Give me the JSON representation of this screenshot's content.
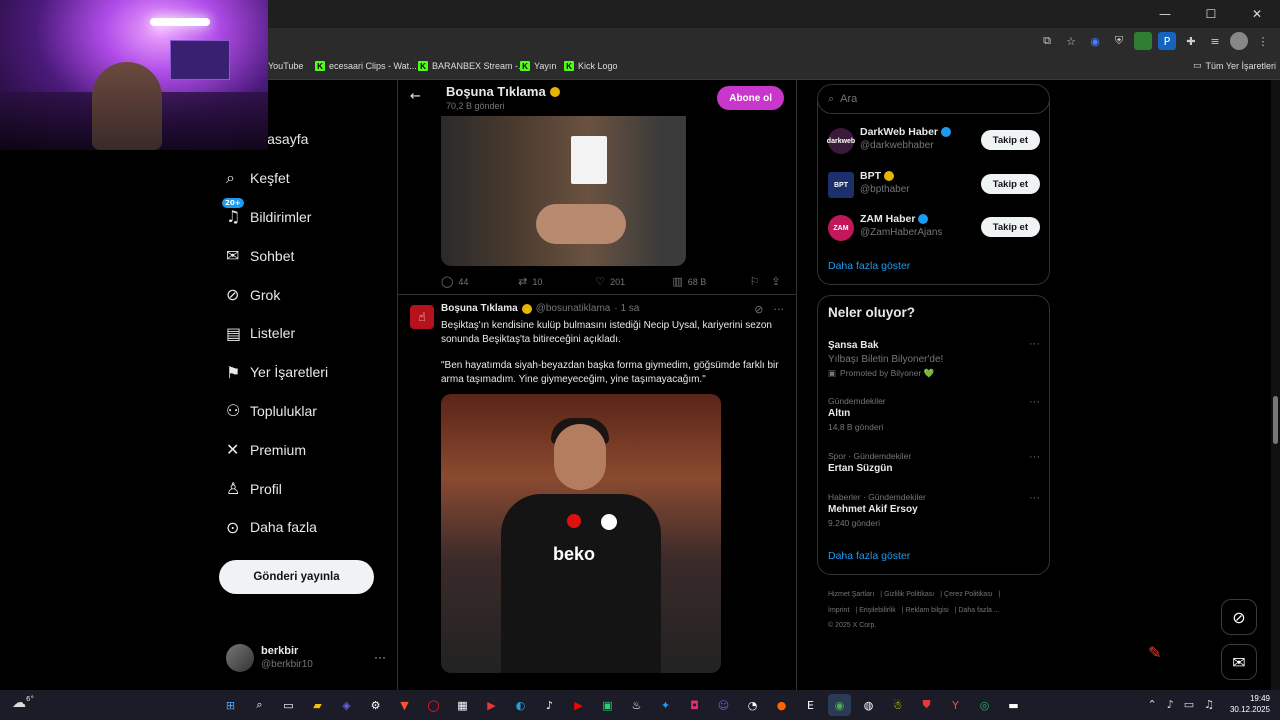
{
  "browser": {
    "window_controls": [
      "—",
      "☐",
      "✕"
    ],
    "bookmarks": [
      {
        "label": "YouTube",
        "icon": "youtube-icon"
      },
      {
        "label": "ecesaari Clips - Wat...",
        "icon": "kick-icon"
      },
      {
        "label": "BARANBEX Stream -...",
        "icon": "kick-icon"
      },
      {
        "label": "Yayın",
        "icon": "kick-icon"
      },
      {
        "label": "Kick Logo",
        "icon": "kick-icon"
      }
    ],
    "all_bookmarks": "Tüm Yer İşaretleri"
  },
  "nav": {
    "items": [
      {
        "label": "Anasayfa",
        "icon": "home-icon"
      },
      {
        "label": "Keşfet",
        "icon": "search-icon"
      },
      {
        "label": "Bildirimler",
        "icon": "bell-icon",
        "badge": "20+"
      },
      {
        "label": "Sohbet",
        "icon": "mail-icon"
      },
      {
        "label": "Grok",
        "icon": "grok-icon"
      },
      {
        "label": "Listeler",
        "icon": "list-icon"
      },
      {
        "label": "Yer İşaretleri",
        "icon": "bookmark-icon"
      },
      {
        "label": "Topluluklar",
        "icon": "communities-icon"
      },
      {
        "label": "Premium",
        "icon": "x-icon"
      },
      {
        "label": "Profil",
        "icon": "person-icon"
      },
      {
        "label": "Daha fazla",
        "icon": "more-circle-icon"
      }
    ],
    "post_button": "Gönderi yayınla",
    "profile": {
      "name": "berkbir",
      "handle": "@berkbir10"
    }
  },
  "center": {
    "header_title": "Boşuna Tıklama",
    "header_sub": "70,2 B gönderi",
    "subscribe": "Abone ol",
    "post1_stats": {
      "replies": "44",
      "reposts": "10",
      "likes": "201",
      "views": "68 B"
    },
    "tweet": {
      "name": "Boşuna Tıklama",
      "handle": "@bosunatiklama",
      "time": "· 1 sa",
      "text1": "Beşiktaş'ın kendisine kulüp bulmasını istediği Necip Uysal, kariyerini sezon sonunda Beşiktaş'ta bitireceğini açıkladı.",
      "text2": "\"Ben hayatımda siyah-beyazdan başka forma giymedim, göğsümde farklı bir arma taşımadım. Yine giymeyeceğim, yine taşımayacağım.\"",
      "jersey": "beko"
    }
  },
  "right": {
    "search_placeholder": "Ara",
    "who_to_follow": [
      {
        "name": "DarkWeb Haber",
        "handle": "@darkwebhaber",
        "verified": "blue",
        "avatar_text": "darkweb",
        "avatar_color": "#3a1a3a"
      },
      {
        "name": "BPT",
        "handle": "@bpthaber",
        "verified": "gold",
        "avatar_text": "BPT",
        "avatar_color": "#1c2f6b"
      },
      {
        "name": "ZAM Haber",
        "handle": "@ZamHaberAjans",
        "verified": "blue",
        "avatar_text": "ZAM",
        "avatar_color": "#c2185b"
      }
    ],
    "follow_label": "Takip et",
    "show_more": "Daha fazla göster",
    "trends_title": "Neler oluyor?",
    "trends": [
      {
        "meta": "",
        "title": "Şansa Bak",
        "sub": "Yılbaşı Biletin Bilyoner'de!",
        "promo": "Promoted by Bilyoner 💚"
      },
      {
        "meta": "Gündemdekiler",
        "title": "Altın",
        "count": "14,8 B gönderi"
      },
      {
        "meta": "Spor · Gündemdekiler",
        "title": "Ertan Süzgün",
        "count": ""
      },
      {
        "meta": "Haberler · Gündemdekiler",
        "title": "Mehmet Akif Ersoy",
        "count": "9.240 gönderi"
      }
    ],
    "footer": [
      "Hizmet Şartları",
      "Gizlilik Politikası",
      "Çerez Politikası",
      "İmprint",
      "Erişilebilirlik",
      "Reklam bilgisi",
      "Daha fazla ...",
      "© 2025 X Corp."
    ]
  },
  "taskbar": {
    "weather": "6°",
    "time": "19:49",
    "date": "30.12.2025"
  }
}
